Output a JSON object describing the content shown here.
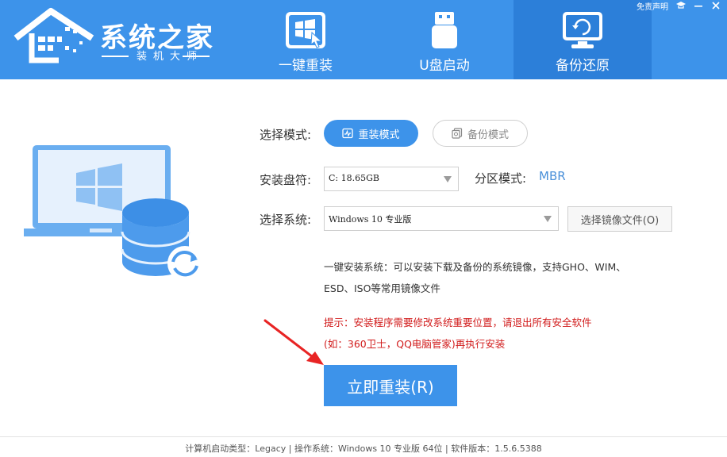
{
  "header": {
    "logo_title": "系统之家",
    "logo_subtitle": "装机大师",
    "tabs": [
      {
        "label": "一键重装",
        "icon": "windows-install-icon",
        "active": false
      },
      {
        "label": "U盘启动",
        "icon": "usb-drive-icon",
        "active": false
      },
      {
        "label": "备份还原",
        "icon": "backup-restore-icon",
        "active": true
      }
    ],
    "disclaimer": "免责声明",
    "top_icons": [
      "graduation-cap-icon",
      "minimize-icon",
      "close-icon"
    ]
  },
  "form": {
    "mode_label": "选择模式:",
    "mode_reinstall": "重装模式",
    "mode_backup": "备份模式",
    "disk_label": "安装盘符:",
    "disk_value": "C: 18.65GB",
    "partition_label": "分区模式:",
    "partition_value": "MBR",
    "system_label": "选择系统:",
    "system_value": "Windows 10 专业版",
    "browse_button": "选择镜像文件(O)",
    "description_line1": "一键安装系统：可以安装下载及备份的系统镜像，支持GHO、WIM、",
    "description_line2": "ESD、ISO等常用镜像文件",
    "warning_line1": "提示：安装程序需要修改系统重要位置，请退出所有安全软件",
    "warning_line2": "(如：360卫士，QQ电脑管家)再执行安装",
    "install_button": "立即重装(R)"
  },
  "footer": {
    "text": "计算机启动类型：Legacy | 操作系统：Windows 10 专业版 64位 | 软件版本：1.5.6.5388"
  },
  "colors": {
    "header_bg": "#3d93ea",
    "active_tab_bg": "#2c7fd9",
    "accent": "#3d93ea",
    "warning": "#d11b1b"
  }
}
